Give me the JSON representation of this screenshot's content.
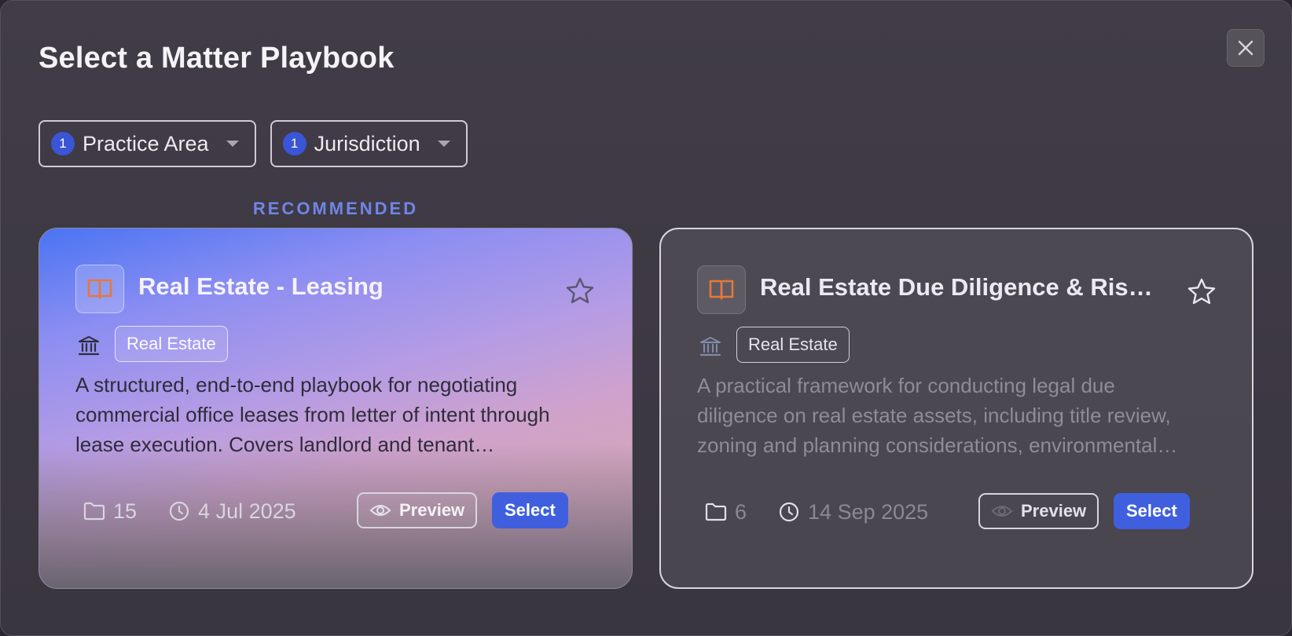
{
  "modal": {
    "title": "Select a Matter Playbook"
  },
  "filters": [
    {
      "count": "1",
      "label": "Practice Area"
    },
    {
      "count": "1",
      "label": "Jurisdiction"
    }
  ],
  "recommended_label": "RECOMMENDED",
  "cards": [
    {
      "title": "Real Estate - Leasing",
      "tag": "Real Estate",
      "description": "A structured, end-to-end playbook for negotiating commercial office leases from letter of intent through lease execution. Covers landlord and tenant considerations.",
      "folder_count": "15",
      "date": "4 Jul 2025",
      "preview_label": "Preview",
      "select_label": "Select"
    },
    {
      "title": "Real Estate Due Diligence & Risk Assessment",
      "tag": "Real Estate",
      "description": "A practical framework for conducting legal due diligence on real estate assets, including title review, zoning and planning considerations, environmental review.",
      "folder_count": "6",
      "date": "14 Sep 2025",
      "preview_label": "Preview",
      "select_label": "Select"
    }
  ],
  "colors": {
    "accent": "#3f5fdf",
    "badge": "#3a55d6",
    "recommended": "#6f86e6",
    "book_icon": "#e6783a"
  }
}
